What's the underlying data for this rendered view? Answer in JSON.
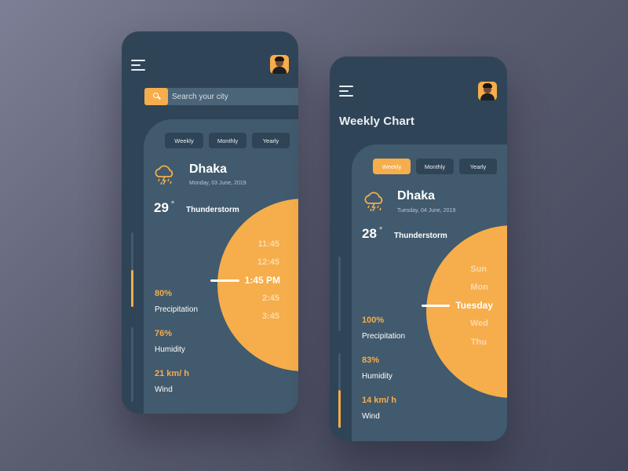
{
  "phone1": {
    "search": {
      "placeholder": "Search your city",
      "value": ""
    },
    "tabs": [
      {
        "label": "Weekly",
        "active": false
      },
      {
        "label": "Monthly",
        "active": false
      },
      {
        "label": "Yearly",
        "active": false
      }
    ],
    "weather": {
      "icon": "cloud-rain-lightning-icon",
      "city": "Dhaka",
      "date": "Monday, 03 June, 2019",
      "temp": "29",
      "degree": "°",
      "condition": "Thunderstorm"
    },
    "picker": {
      "items": [
        "11:45",
        "12:45",
        "1:45 PM",
        "2:45",
        "3:45"
      ],
      "selected": "1:45 PM"
    },
    "stats": [
      {
        "value": "80%",
        "label": "Precipitation"
      },
      {
        "value": "76%",
        "label": "Humidity"
      },
      {
        "value": "21 km/ h",
        "label": "Wind"
      }
    ]
  },
  "phone2": {
    "title": "Weekly Chart",
    "tabs": [
      {
        "label": "Weekly",
        "active": true
      },
      {
        "label": "Monthly",
        "active": false
      },
      {
        "label": "Yearly",
        "active": false
      }
    ],
    "weather": {
      "icon": "cloud-rain-lightning-icon",
      "city": "Dhaka",
      "date": "Tuesday, 04 June, 2019",
      "temp": "28",
      "degree": "°",
      "condition": "Thunderstorm"
    },
    "picker": {
      "items": [
        "Sun",
        "Mon",
        "Tuesday",
        "Wed",
        "Thu"
      ],
      "selected": "Tuesday"
    },
    "stats": [
      {
        "value": "100%",
        "label": "Precipitation"
      },
      {
        "value": "83%",
        "label": "Humidity"
      },
      {
        "value": "14 km/ h",
        "label": "Wind"
      }
    ]
  },
  "colors": {
    "accent": "#f6ad4b",
    "phone_bg": "#2f4557",
    "card_bg": "#415a6d"
  }
}
